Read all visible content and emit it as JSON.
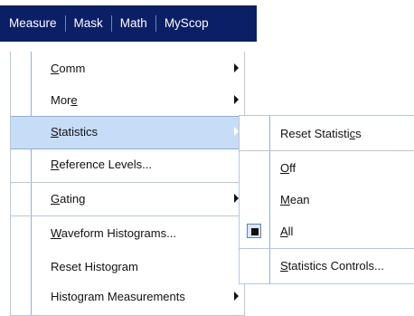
{
  "menubar": {
    "items": [
      "Measure",
      "Mask",
      "Math",
      "MyScop"
    ]
  },
  "menu": {
    "items": [
      {
        "pre": "",
        "ul": "C",
        "post": "omm",
        "submenu": true
      },
      {
        "pre": "Mor",
        "ul": "e",
        "post": "",
        "submenu": true
      },
      {
        "pre": "",
        "ul": "S",
        "post": "tatistics",
        "submenu": true,
        "highlighted": true
      },
      {
        "pre": "",
        "ul": "R",
        "post": "eference Levels...",
        "submenu": false
      },
      {
        "pre": "",
        "ul": "G",
        "post": "ating",
        "submenu": true
      },
      {
        "pre": "",
        "ul": "W",
        "post": "aveform Histograms...",
        "submenu": false
      },
      {
        "pre": "Reset Histogram",
        "ul": "",
        "post": "",
        "submenu": false
      },
      {
        "pre": "Histo",
        "ul": "g",
        "post": "ram Measurements",
        "submenu": true
      }
    ]
  },
  "submenu": {
    "items": [
      {
        "pre": "Reset Statisti",
        "ul": "c",
        "post": "s",
        "checked": false
      },
      {
        "pre": "",
        "ul": "O",
        "post": "ff",
        "checked": false
      },
      {
        "pre": "",
        "ul": "M",
        "post": "ean",
        "checked": false
      },
      {
        "pre": "",
        "ul": "A",
        "post": "ll",
        "checked": true
      },
      {
        "pre": "",
        "ul": "S",
        "post": "tatistics Controls...",
        "checked": false
      }
    ]
  },
  "colors": {
    "menubar_bg": "#0b1f66",
    "highlight_bg": "#c7dcf7",
    "separator": "#b7c6de"
  }
}
